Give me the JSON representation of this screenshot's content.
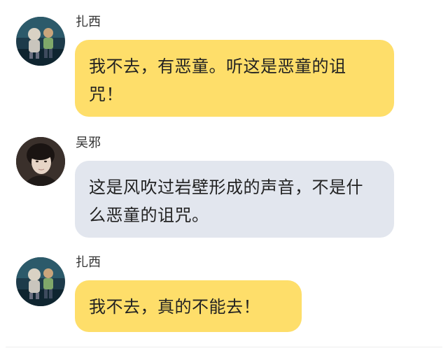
{
  "messages": [
    {
      "sender": "扎西",
      "text": "我不去，有恶童。听这是恶童的诅咒！",
      "avatar_icon": "cartoon-characters-avatar",
      "bubble_color": "#fede6a"
    },
    {
      "sender": "吴邪",
      "text": "这是风吹过岩壁形成的声音，不是什么恶童的诅咒。",
      "avatar_icon": "young-man-photo-avatar",
      "bubble_color": "#e2e6ee"
    },
    {
      "sender": "扎西",
      "text": "我不去，真的不能去！",
      "avatar_icon": "cartoon-characters-avatar",
      "bubble_color": "#fede6a"
    }
  ]
}
